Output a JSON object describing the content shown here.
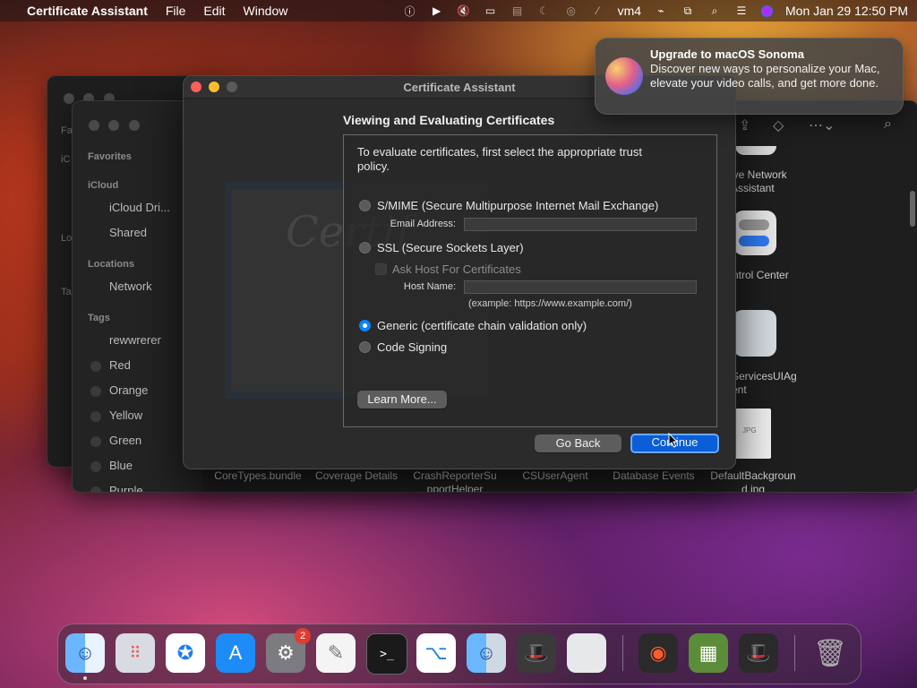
{
  "menubar": {
    "app_name": "Certificate Assistant",
    "menus": [
      "File",
      "Edit",
      "Window"
    ],
    "user": "vm4",
    "clock": "Mon Jan 29  12:50 PM"
  },
  "finder": {
    "sidebar": {
      "favorites_head": "Favorites",
      "icloud_head": "iCloud",
      "icloud_items": [
        "iCloud Dri...",
        "Shared"
      ],
      "locations_head": "Locations",
      "locations_items": [
        "Network"
      ],
      "tags_head": "Tags",
      "tags": [
        "rewwrerer",
        "Red",
        "Orange",
        "Yellow",
        "Green",
        "Blue",
        "Purple"
      ]
    },
    "back_letters": [
      "Fa",
      "iC",
      "Lo",
      "Ta"
    ],
    "files_right": [
      "ive Network\nAssistant",
      "ntrol Center",
      "ServicesUIAg\nent",
      "DefaultBackgroun\nd.jpg"
    ],
    "files_bottom": [
      "CoreTypes.bundle",
      "Coverage Details",
      "CrashReporterSu\npportHelper",
      "CSUserAgent",
      "Database Events"
    ],
    "jpg_label": "JPG"
  },
  "dialog": {
    "title": "Certificate Assistant",
    "heading": "Viewing and Evaluating Certificates",
    "watermark": "Certif",
    "intro": "To evaluate certificates, first select the appropriate trust policy.",
    "options": {
      "smime": "S/MIME (Secure Multipurpose Internet Mail Exchange)",
      "ssl": "SSL (Secure Sockets Layer)",
      "generic": "Generic (certificate chain validation only)",
      "codesign": "Code Signing"
    },
    "email_label": "Email Address:",
    "ask_host_label": "Ask Host For Certificates",
    "host_label": "Host Name:",
    "example_text": "(example: https://www.example.com/)",
    "selected": "generic",
    "learn_more": "Learn More...",
    "go_back": "Go Back",
    "continue": "Continue"
  },
  "notification": {
    "title": "Upgrade to macOS Sonoma",
    "body": "Discover new ways to personalize your Mac, elevate your video calls, and get more done."
  },
  "dock": {
    "badge_count": "2",
    "apps": [
      "Finder",
      "Launchpad",
      "Safari",
      "App Store",
      "System Settings",
      "TextEdit",
      "Terminal",
      "Visual Studio Code",
      "Migration Assistant",
      "Bartender",
      "Preview",
      "Quick Look",
      "Minecraft",
      "Bartender 2",
      "Trash"
    ]
  }
}
